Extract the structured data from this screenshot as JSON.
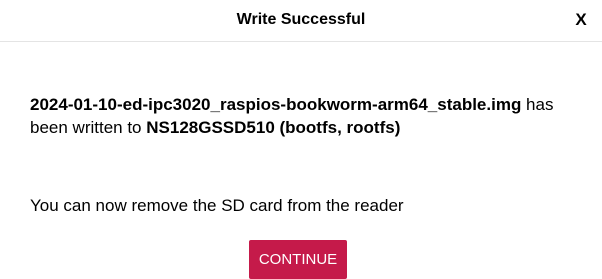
{
  "dialog": {
    "title": "Write Successful",
    "close_label": "X"
  },
  "message": {
    "image_name": "2024-01-10-ed-ipc3020_raspios-bookworm-arm64_stable.img",
    "connector": " has been written to ",
    "device": "NS128GSSD510 (bootfs, rootfs)"
  },
  "note": "You can now remove the SD card from the reader",
  "buttons": {
    "continue_label": "CONTINUE"
  },
  "colors": {
    "button_accent": "#c51a4a"
  }
}
